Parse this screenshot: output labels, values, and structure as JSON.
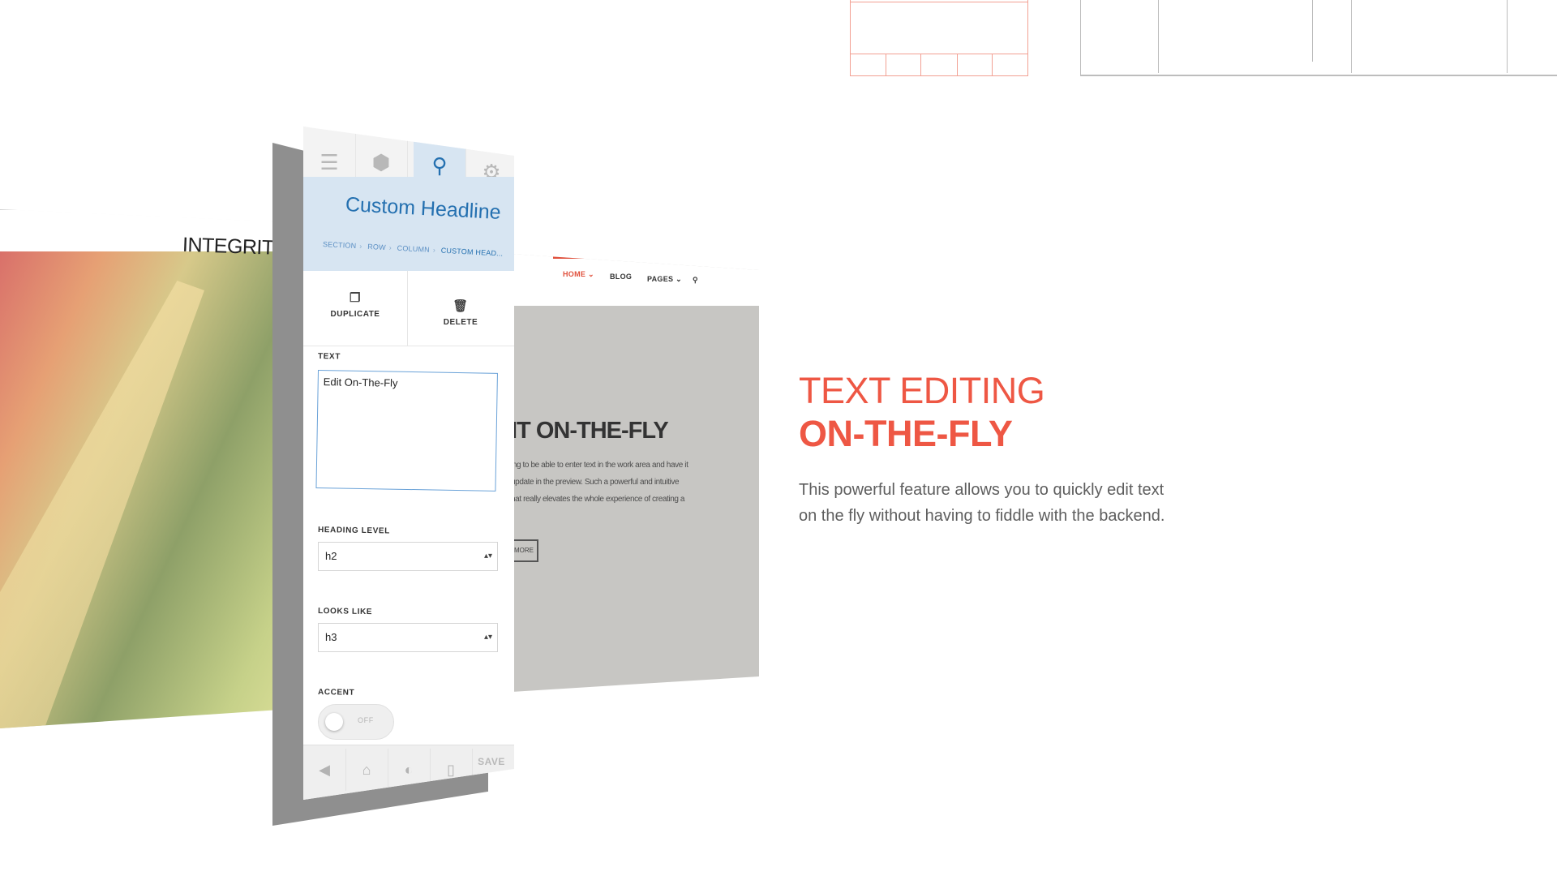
{
  "background_site": {
    "logo_text": "INTEGRITY"
  },
  "preview_site": {
    "nav": [
      "HOME",
      "BLOG",
      "PAGES"
    ],
    "headline": "IT ON-THE-FLY",
    "body_lines": [
      "ing to be able to enter text in the work area and have it",
      "update in the preview. Such a powerful and intuitive",
      "hat really elevates the whole experience of creating a"
    ],
    "button_label": "MORE"
  },
  "builder": {
    "tabs": [
      {
        "icon": "layout-icon"
      },
      {
        "icon": "cube-icon"
      },
      {
        "icon": "search-icon",
        "active": true
      },
      {
        "icon": "gear-icon"
      }
    ],
    "panel_title": "Custom Headline",
    "breadcrumbs": [
      "SECTION",
      "ROW",
      "COLUMN",
      "CUSTOM HEAD..."
    ],
    "actions": {
      "duplicate": "DUPLICATE",
      "delete": "DELETE"
    },
    "fields": {
      "text_label": "TEXT",
      "text_value": "Edit On-The-Fly",
      "heading_level_label": "HEADING LEVEL",
      "heading_level_value": "h2",
      "looks_like_label": "LOOKS LIKE",
      "looks_like_value": "h3",
      "accent_label": "ACCENT",
      "accent_state": "OFF"
    },
    "footer": {
      "save_label": "SAVE"
    }
  },
  "feature": {
    "title_line1": "TEXT EDITING",
    "title_line2": "ON-THE-FLY",
    "description": "This powerful feature allows you to quickly edit text on the fly without having to fiddle with the backend."
  },
  "colors": {
    "accent_red": "#ee5744",
    "builder_blue": "#2470b0",
    "builder_header_bg": "#d7e5f2"
  }
}
